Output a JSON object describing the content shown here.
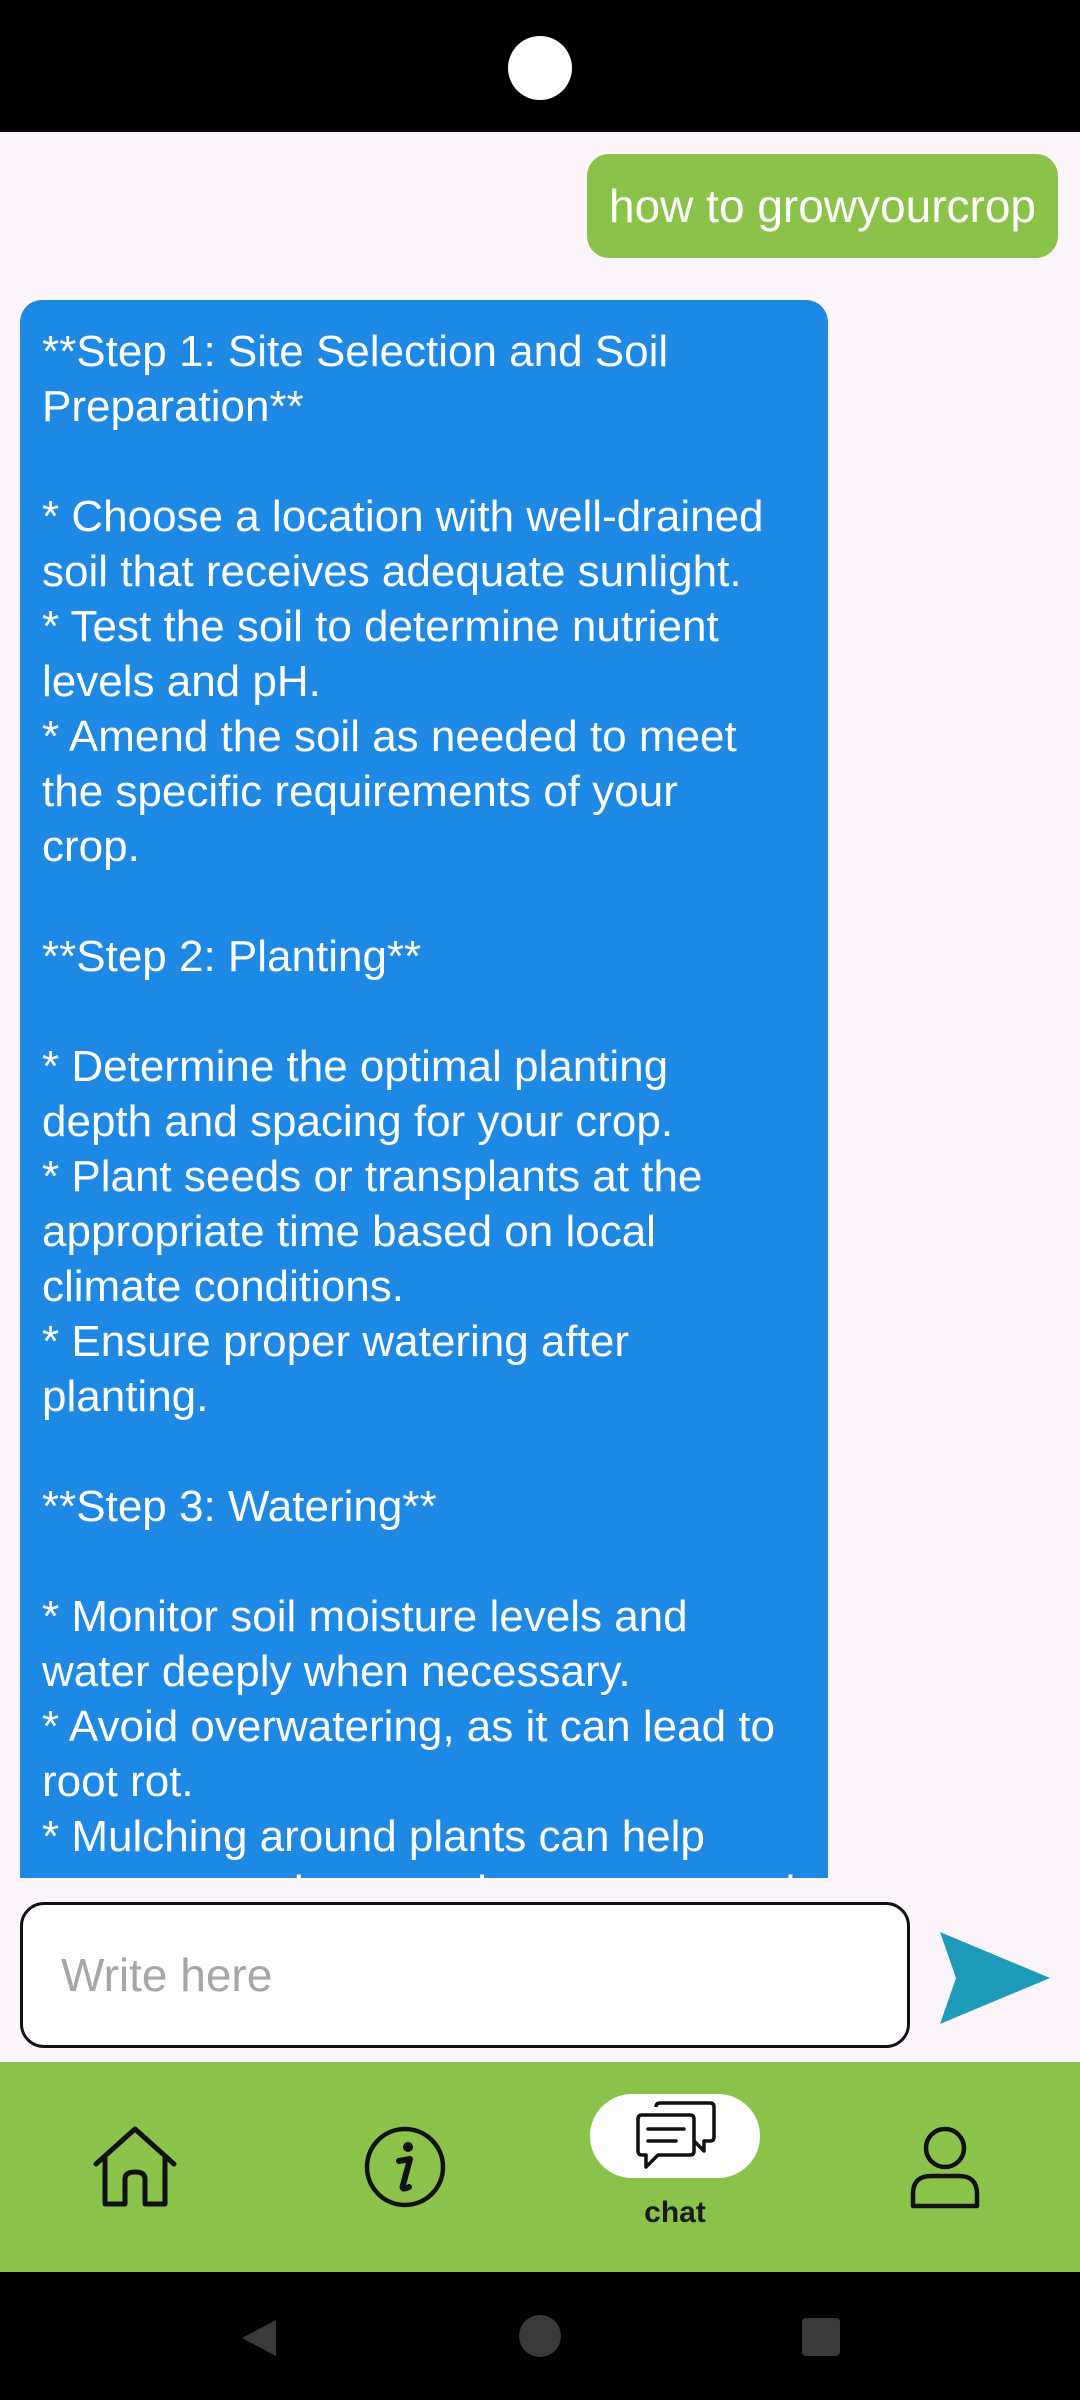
{
  "chat": {
    "user_message": "how to growyourcrop",
    "bot_message_lines": [
      "**Step 1: Site Selection and Soil",
      "Preparation**",
      "",
      "* Choose a location with well-drained",
      "soil that receives adequate sunlight.",
      "* Test the soil to determine nutrient",
      "levels and pH.",
      "* Amend the soil as needed to meet",
      "the specific requirements of your",
      "crop.",
      "",
      "**Step 2: Planting**",
      "",
      "* Determine the optimal planting",
      "depth and spacing for your crop.",
      "* Plant seeds or transplants at the",
      "appropriate time based on local",
      "climate conditions.",
      "* Ensure proper watering after",
      "planting.",
      "",
      "**Step 3: Watering**",
      "",
      "* Monitor soil moisture levels and",
      "water deeply when necessary.",
      "* Avoid overwatering, as it can lead to",
      "root rot.",
      "* Mulching around plants can help",
      "conserve moisture and suppress weeds."
    ]
  },
  "composer": {
    "placeholder": "Write here",
    "send_icon": "send-icon"
  },
  "bottom_nav": {
    "items": [
      {
        "id": "home",
        "icon": "home-icon",
        "label": ""
      },
      {
        "id": "info",
        "icon": "info-icon",
        "label": ""
      },
      {
        "id": "chat",
        "icon": "chat-icon",
        "label": "chat",
        "active": true
      },
      {
        "id": "profile",
        "icon": "person-icon",
        "label": ""
      }
    ]
  },
  "colors": {
    "accent_green": "#8bc34a",
    "bot_bubble_blue": "#1e88e5",
    "send_teal": "#1e9bb8",
    "background": "#fcf5fc"
  }
}
